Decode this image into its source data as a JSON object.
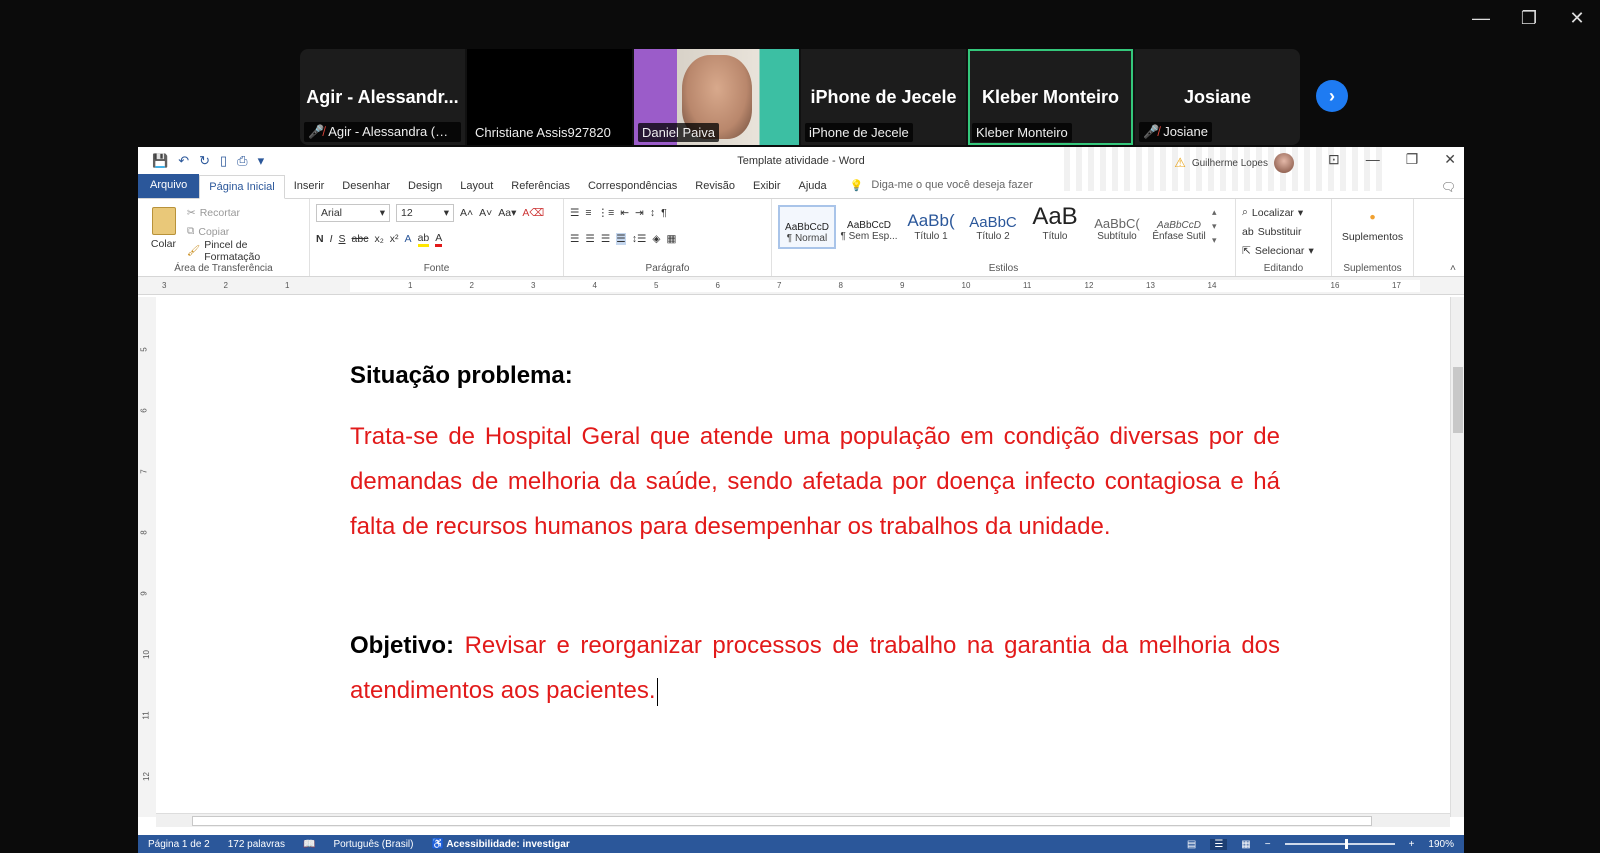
{
  "zoom_window": {
    "controls": {
      "minimize": "—",
      "restore": "❐",
      "close": "✕"
    },
    "participants": [
      {
        "display": "Agir  -  Alessandr...",
        "label": "Agir - Alessandra (NC...",
        "muted": true
      },
      {
        "display": "",
        "label": "Christiane Assis927820",
        "muted": false
      },
      {
        "display": "",
        "label": "Daniel Paiva",
        "muted": false,
        "video": true
      },
      {
        "display": "iPhone de Jecele",
        "label": "iPhone de Jecele",
        "muted": false
      },
      {
        "display": "Kleber Monteiro",
        "label": "Kleber Monteiro",
        "muted": false,
        "active": true
      },
      {
        "display": "Josiane",
        "label": "Josiane",
        "muted": true
      }
    ],
    "next_icon": "›"
  },
  "word": {
    "title": "Template atividade  -  Word",
    "user_name": "Guilherme Lopes",
    "window_controls": {
      "min": "—",
      "restore": "❐",
      "close": "✕"
    },
    "tabs": [
      "Arquivo",
      "Página Inicial",
      "Inserir",
      "Desenhar",
      "Design",
      "Layout",
      "Referências",
      "Correspondências",
      "Revisão",
      "Exibir",
      "Ajuda"
    ],
    "tell_me": "Diga-me o que você deseja fazer",
    "ribbon": {
      "clipboard": {
        "paste": "Colar",
        "cut": "Recortar",
        "copy": "Copiar",
        "format_painter": "Pincel de Formatação",
        "group": "Área de Transferência"
      },
      "font": {
        "name": "Arial",
        "size": "12",
        "group": "Fonte"
      },
      "paragraph": {
        "group": "Parágrafo"
      },
      "styles": {
        "items": [
          {
            "sample": "AaBbCcD",
            "name": "¶ Normal"
          },
          {
            "sample": "AaBbCcD",
            "name": "¶ Sem Esp..."
          },
          {
            "sample": "AaBb(",
            "name": "Título 1"
          },
          {
            "sample": "AaBbC",
            "name": "Título 2"
          },
          {
            "sample": "AaB",
            "name": "Título"
          },
          {
            "sample": "AaBbC(",
            "name": "Subtítulo"
          },
          {
            "sample": "AaBbCcD",
            "name": "Ênfase Sutil"
          }
        ],
        "group": "Estilos"
      },
      "editing": {
        "find": "Localizar",
        "replace": "Substituir",
        "select": "Selecionar",
        "group": "Editando"
      },
      "addins": {
        "label": "Suplementos",
        "group": "Suplementos"
      }
    },
    "document": {
      "heading": "Situação problema:",
      "paragraph": "Trata-se de Hospital Geral que atende uma população em condição diversas por de demandas de melhoria da saúde, sendo afetada por doença infecto contagiosa e há falta de recursos humanos para desempenhar os trabalhos da unidade.",
      "objective_label": "Objetivo:",
      "objective_text": "Revisar e reorganizar processos de trabalho na garantia da melhoria dos atendimentos aos pacientes."
    },
    "status": {
      "page": "Página 1 de 2",
      "words": "172 palavras",
      "language": "Português (Brasil)",
      "accessibility": "Acessibilidade: investigar",
      "zoom": "190%"
    }
  }
}
